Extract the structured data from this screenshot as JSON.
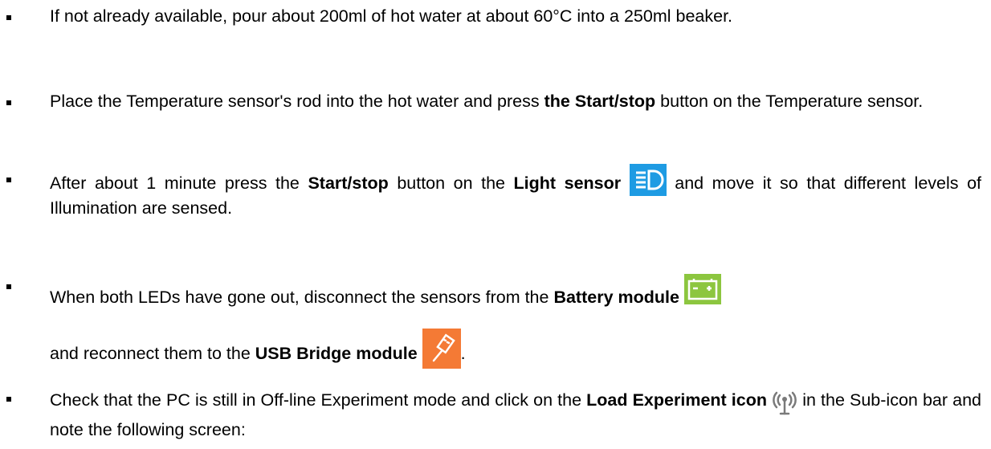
{
  "bullets": [
    {
      "text": "If not already available, pour about 200ml of hot water at about 60°C into a 250ml beaker."
    },
    {
      "t1": "Place the Temperature sensor's rod into the hot water and press ",
      "b1": "the Start/stop",
      "t2": " button on the Temperature sensor."
    },
    {
      "t1": "After about 1 minute press the ",
      "b1": "Start/stop",
      "t2": " button on the ",
      "b2": "Light sensor",
      "t3": " and move it so that different levels of Illumination are sensed."
    },
    {
      "t1": "When both LEDs have gone out, disconnect the sensors from the ",
      "b1": "Battery module",
      "t2": "and reconnect them to the ",
      "b2": "USB Bridge module",
      "t3": "."
    },
    {
      "t1": "Check that the PC is still in Off-line Experiment mode and click on the ",
      "b1": "Load Experiment icon",
      "t2": " in the Sub-icon bar and note the following screen:"
    }
  ],
  "icons": {
    "light_sensor": "light-sensor-icon",
    "battery_module": "battery-module-icon",
    "usb_bridge": "usb-bridge-icon",
    "load_experiment": "load-experiment-icon"
  },
  "colors": {
    "light_sensor": "#1e9be3",
    "battery_module": "#8cc63f",
    "usb_bridge": "#f47a35",
    "antenna": "#7a7a7a"
  }
}
